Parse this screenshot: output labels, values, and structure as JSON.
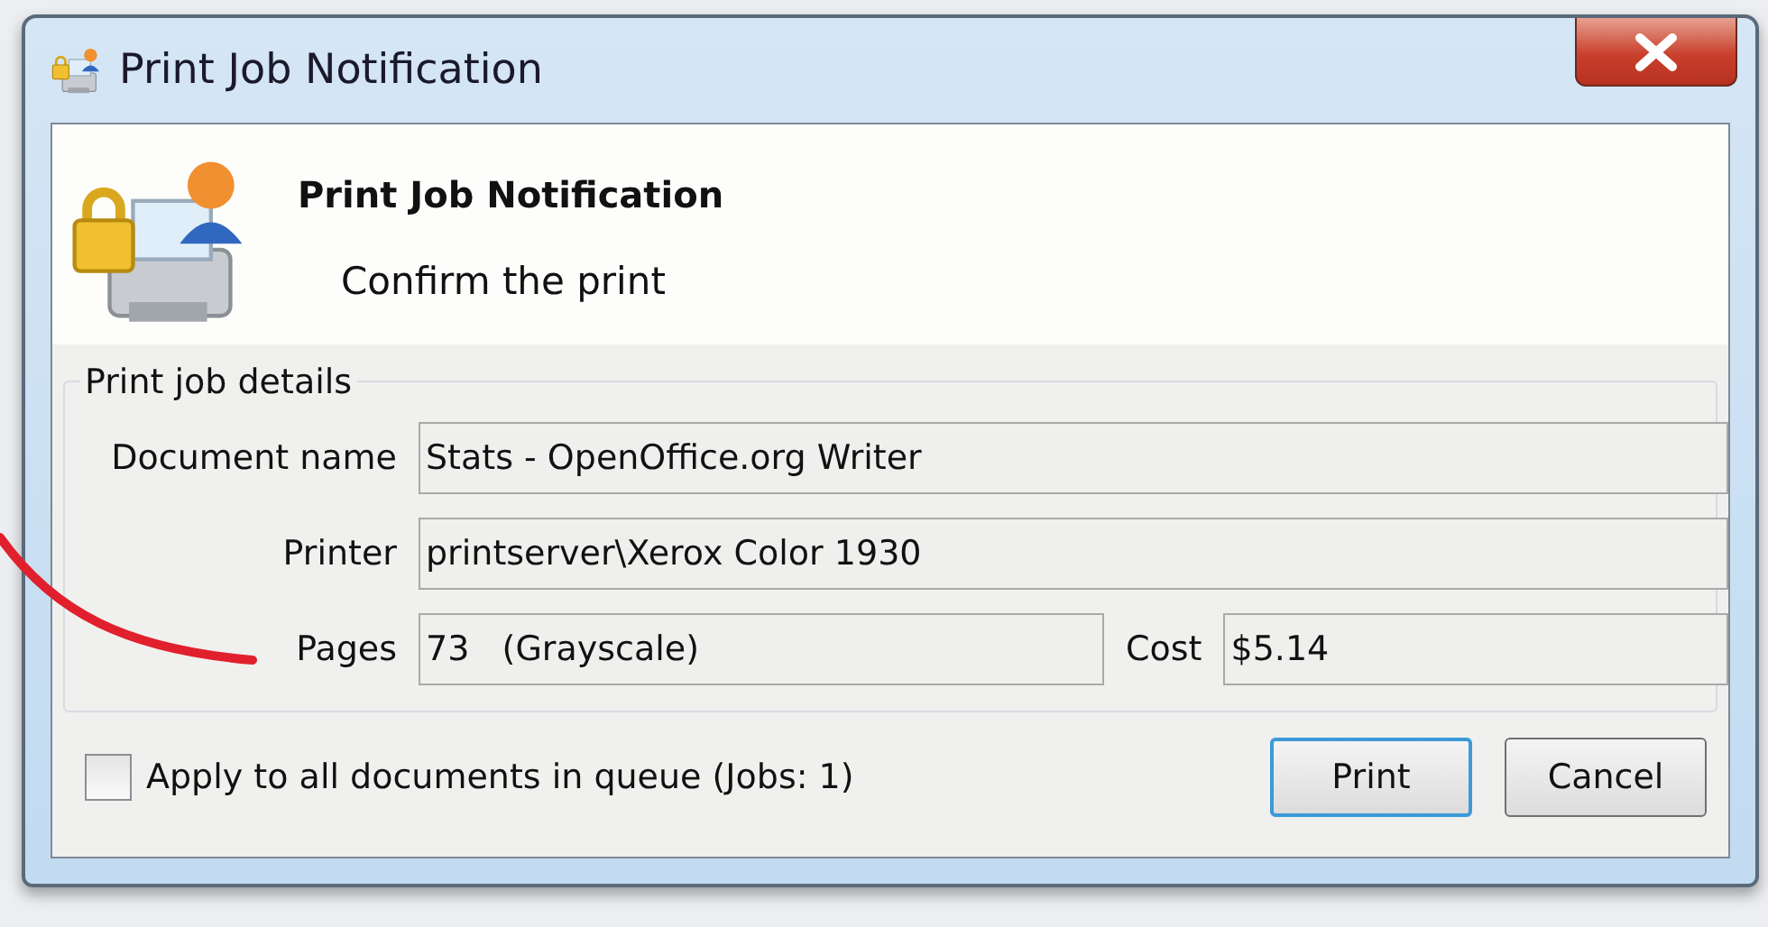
{
  "window": {
    "title": "Print Job Notification"
  },
  "header": {
    "title": "Print Job Notification",
    "subtitle": "Confirm the print"
  },
  "details": {
    "legend": "Print job details",
    "fields": [
      {
        "label": "Document name",
        "value": "Stats - OpenOffice.org Writer"
      },
      {
        "label": "Printer",
        "value": "printserver\\Xerox Color 1930"
      },
      {
        "label": "Pages",
        "value": "73   (Grayscale)"
      },
      {
        "label": "Cost",
        "value": "$5.14"
      }
    ]
  },
  "apply_all": {
    "label": "Apply to all documents in queue (Jobs: 1)",
    "checked": false
  },
  "buttons": [
    {
      "label": "Print",
      "selected": true
    },
    {
      "label": "Cancel",
      "selected": false
    }
  ]
}
